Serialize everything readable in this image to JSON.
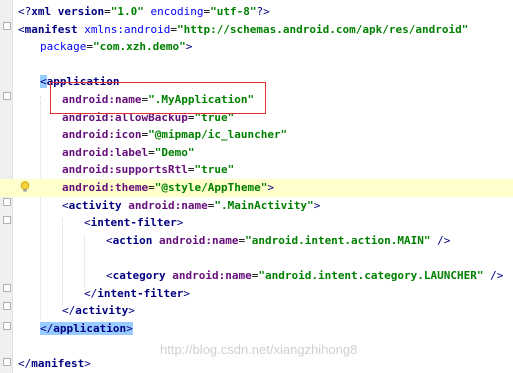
{
  "lines": [
    {
      "indent": 0,
      "parts": [
        {
          "t": "<?",
          "c": "tag"
        },
        {
          "t": "xml version",
          "c": "tag-bold"
        },
        {
          "t": "=",
          "c": "txt"
        },
        {
          "t": "\"1.0\"",
          "c": "aval"
        },
        {
          "t": " encoding",
          "c": "attr"
        },
        {
          "t": "=",
          "c": "txt"
        },
        {
          "t": "\"utf-8\"",
          "c": "aval"
        },
        {
          "t": "?>",
          "c": "tag"
        }
      ]
    },
    {
      "indent": 0,
      "parts": [
        {
          "t": "<",
          "c": "tag"
        },
        {
          "t": "manifest ",
          "c": "tag-bold"
        },
        {
          "t": "xmlns:android",
          "c": "attr"
        },
        {
          "t": "=",
          "c": "txt"
        },
        {
          "t": "\"http://schemas.android.com/apk/res/android\"",
          "c": "aval"
        }
      ]
    },
    {
      "indent": 1,
      "parts": [
        {
          "t": "package",
          "c": "attr"
        },
        {
          "t": "=",
          "c": "txt"
        },
        {
          "t": "\"com.xzh.demo\"",
          "c": "aval"
        },
        {
          "t": ">",
          "c": "tag"
        }
      ]
    },
    {
      "indent": 0,
      "parts": []
    },
    {
      "indent": 1,
      "parts": [
        {
          "t": "<",
          "c": "tag boxhl"
        },
        {
          "t": "application",
          "c": "tag-bold"
        }
      ]
    },
    {
      "indent": 2,
      "parts": [
        {
          "t": "android:",
          "c": "nsattr"
        },
        {
          "t": "name",
          "c": "nsattr"
        },
        {
          "t": "=",
          "c": "txt"
        },
        {
          "t": "\".MyApplication\"",
          "c": "aval"
        }
      ]
    },
    {
      "indent": 2,
      "parts": [
        {
          "t": "android:",
          "c": "nsattr"
        },
        {
          "t": "allowBackup",
          "c": "nsattr"
        },
        {
          "t": "=",
          "c": "txt"
        },
        {
          "t": "\"true\"",
          "c": "aval"
        }
      ]
    },
    {
      "indent": 2,
      "parts": [
        {
          "t": "android:",
          "c": "nsattr"
        },
        {
          "t": "icon",
          "c": "nsattr"
        },
        {
          "t": "=",
          "c": "txt"
        },
        {
          "t": "\"@mipmap/ic_launcher\"",
          "c": "aval"
        }
      ]
    },
    {
      "indent": 2,
      "parts": [
        {
          "t": "android:",
          "c": "nsattr"
        },
        {
          "t": "label",
          "c": "nsattr"
        },
        {
          "t": "=",
          "c": "txt"
        },
        {
          "t": "\"Demo\"",
          "c": "aval"
        }
      ]
    },
    {
      "indent": 2,
      "parts": [
        {
          "t": "android:",
          "c": "nsattr"
        },
        {
          "t": "supportsRtl",
          "c": "nsattr"
        },
        {
          "t": "=",
          "c": "txt"
        },
        {
          "t": "\"true\"",
          "c": "aval"
        }
      ]
    },
    {
      "indent": 2,
      "hl": true,
      "parts": [
        {
          "t": "android:",
          "c": "nsattr"
        },
        {
          "t": "theme",
          "c": "nsattr"
        },
        {
          "t": "=",
          "c": "txt"
        },
        {
          "t": "\"@style/AppTheme\"",
          "c": "aval"
        },
        {
          "t": ">",
          "c": "tag"
        }
      ]
    },
    {
      "indent": 2,
      "parts": [
        {
          "t": "<",
          "c": "tag"
        },
        {
          "t": "activity ",
          "c": "tag-bold"
        },
        {
          "t": "android:",
          "c": "nsattr"
        },
        {
          "t": "name",
          "c": "nsattr"
        },
        {
          "t": "=",
          "c": "txt"
        },
        {
          "t": "\".MainActivity\"",
          "c": "aval"
        },
        {
          "t": ">",
          "c": "tag"
        }
      ]
    },
    {
      "indent": 3,
      "parts": [
        {
          "t": "<",
          "c": "tag"
        },
        {
          "t": "intent-filter",
          "c": "tag-bold"
        },
        {
          "t": ">",
          "c": "tag"
        }
      ]
    },
    {
      "indent": 4,
      "parts": [
        {
          "t": "<",
          "c": "tag"
        },
        {
          "t": "action ",
          "c": "tag-bold"
        },
        {
          "t": "android:",
          "c": "nsattr"
        },
        {
          "t": "name",
          "c": "nsattr"
        },
        {
          "t": "=",
          "c": "txt"
        },
        {
          "t": "\"android.intent.action.MAIN\"",
          "c": "aval"
        },
        {
          "t": " />",
          "c": "tag"
        }
      ]
    },
    {
      "indent": 0,
      "parts": []
    },
    {
      "indent": 4,
      "parts": [
        {
          "t": "<",
          "c": "tag"
        },
        {
          "t": "category ",
          "c": "tag-bold"
        },
        {
          "t": "android:",
          "c": "nsattr"
        },
        {
          "t": "name",
          "c": "nsattr"
        },
        {
          "t": "=",
          "c": "txt"
        },
        {
          "t": "\"android.intent.category.LAUNCHER\"",
          "c": "aval"
        },
        {
          "t": " />",
          "c": "tag"
        }
      ]
    },
    {
      "indent": 3,
      "parts": [
        {
          "t": "</",
          "c": "tag"
        },
        {
          "t": "intent-filter",
          "c": "tag-bold"
        },
        {
          "t": ">",
          "c": "tag"
        }
      ]
    },
    {
      "indent": 2,
      "parts": [
        {
          "t": "</",
          "c": "tag"
        },
        {
          "t": "activity",
          "c": "tag-bold"
        },
        {
          "t": ">",
          "c": "tag"
        }
      ]
    },
    {
      "indent": 1,
      "parts": [
        {
          "t": "</",
          "c": "tag boxhl"
        },
        {
          "t": "application",
          "c": "tag-bold boxhl"
        },
        {
          "t": ">",
          "c": "tag boxhl"
        }
      ]
    },
    {
      "indent": 0,
      "parts": []
    },
    {
      "indent": 0,
      "parts": [
        {
          "t": "</",
          "c": "tag"
        },
        {
          "t": "manifest",
          "c": "tag-bold"
        },
        {
          "t": ">",
          "c": "tag"
        }
      ]
    }
  ],
  "watermark": "http://blog.csdn.net/xiangzhihong8",
  "colors": {
    "highlight_box": "#e03030",
    "current_line": "#ffffcc",
    "tag_match": "#99ccff"
  },
  "icons": {
    "intention": "lightbulb-icon"
  }
}
